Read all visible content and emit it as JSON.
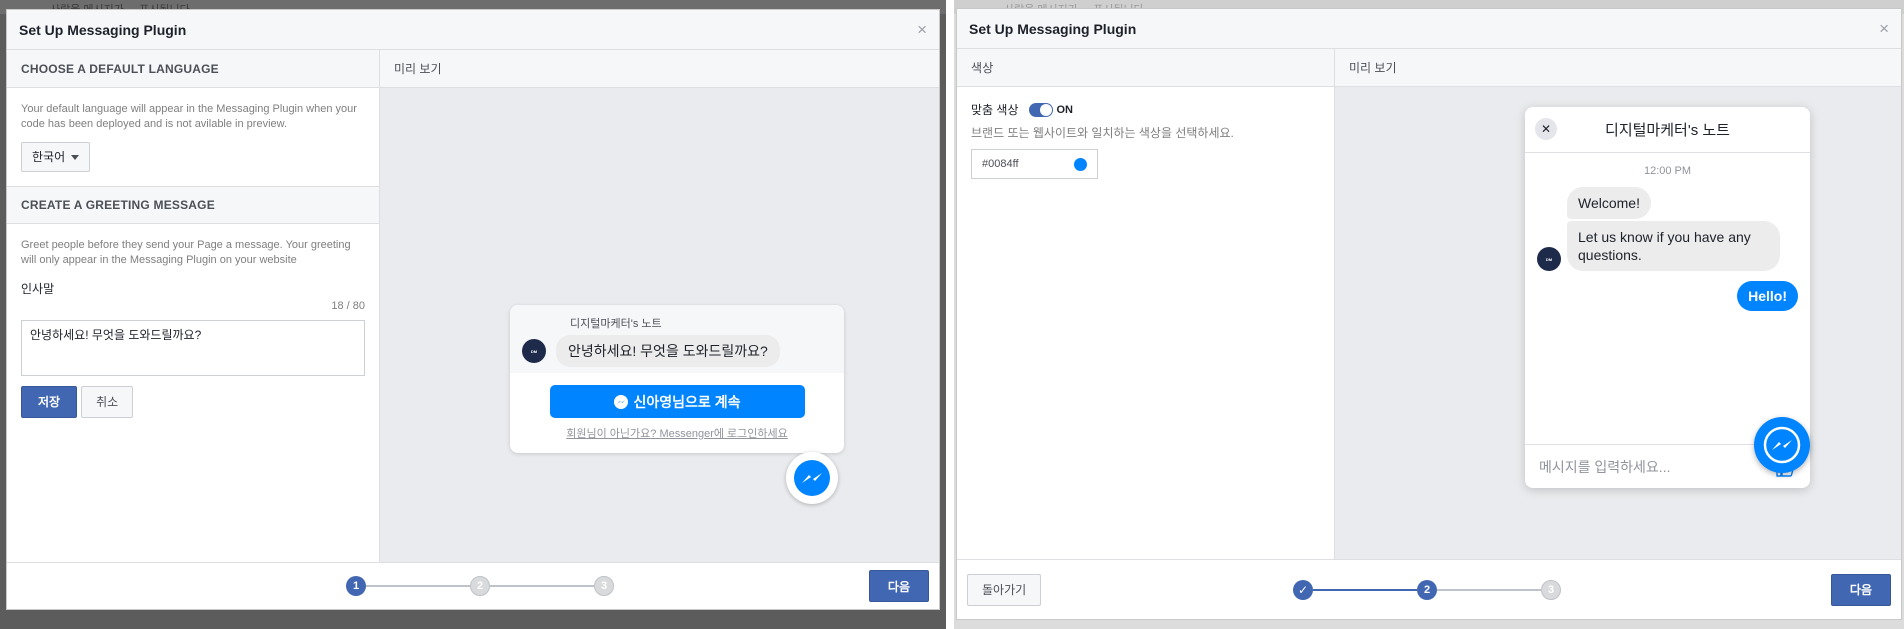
{
  "left": {
    "bg_text": "사람을 메시지가 ... 표시됩니다",
    "dialog_title": "Set Up Messaging Plugin",
    "close_glyph": "×",
    "lang_section": {
      "heading": "CHOOSE A DEFAULT LANGUAGE",
      "description": "Your default language will appear in the Messaging Plugin when your code has been deployed and is not avilable in preview.",
      "selected_language": "한국어"
    },
    "greeting_section": {
      "heading": "CREATE A GREETING MESSAGE",
      "description": "Greet people before they send your Page a message. Your greeting will only appear in the Messaging Plugin on your website",
      "field_label": "인사말",
      "counter": "18 / 80",
      "value": "안녕하세요! 무엇을 도와드릴까요?",
      "save_label": "저장",
      "cancel_label": "취소"
    },
    "preview": {
      "heading": "미리 보기",
      "page_name": "디지털마케터's 노트",
      "greeting": "안녕하세요! 무엇을 도와드릴까요?",
      "continue_label": "신아영님으로 계속",
      "not_you_link": "회원님이 아닌가요? Messenger에 로그인하세요"
    },
    "steps": [
      "1",
      "2",
      "3"
    ],
    "next_label": "다음"
  },
  "right": {
    "bg_text": "사람을 메시지가 ... 표시됩니다",
    "dialog_title": "Set Up Messaging Plugin",
    "close_glyph": "×",
    "color_section": {
      "heading": "색상",
      "toggle_label": "맞춤 색상",
      "toggle_state": "ON",
      "hint": "브랜드 또는 웹사이트와 일치하는 색상을 선택하세요.",
      "color_value": "#0084ff"
    },
    "preview": {
      "heading": "미리 보기",
      "chat_title": "디지털마케터's 노트",
      "close_glyph": "✕",
      "time": "12:00 PM",
      "messages_in": [
        "Welcome!",
        "Let us know if you have any questions."
      ],
      "message_out": "Hello!",
      "input_placeholder": "메시지를 입력하세요..."
    },
    "steps": [
      "✓",
      "2",
      "3"
    ],
    "back_label": "돌아가기",
    "next_label": "다음"
  },
  "colors": {
    "brand": "#4267b2",
    "messenger": "#0084ff"
  }
}
